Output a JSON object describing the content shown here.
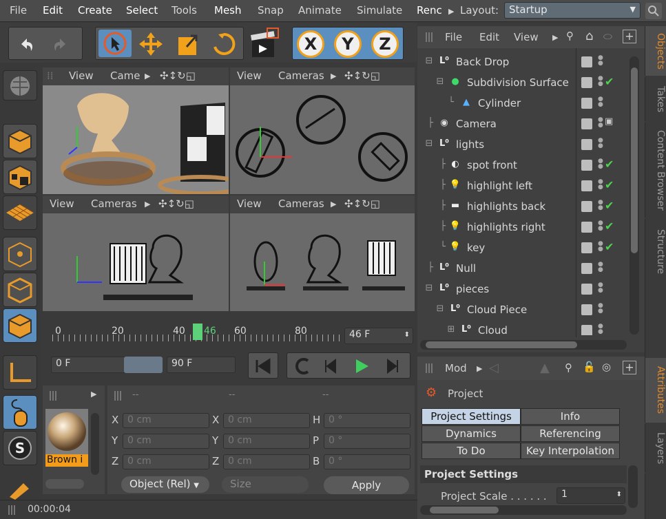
{
  "menubar": {
    "items": [
      "File",
      "Edit",
      "Create",
      "Select",
      "Tools",
      "Mesh",
      "Snap",
      "Animate",
      "Simulate",
      "Renc"
    ],
    "layout_label": "Layout:",
    "layout_value": "Startup"
  },
  "viewports": [
    {
      "view": "View",
      "cameras": "Came"
    },
    {
      "view": "View",
      "cameras": "Cameras"
    },
    {
      "view": "View",
      "cameras": "Cameras"
    },
    {
      "view": "View",
      "cameras": "Cameras"
    }
  ],
  "toolbar": {
    "x": "X",
    "y": "Y",
    "z": "Z"
  },
  "objects": {
    "menu": [
      "File",
      "Edit",
      "View"
    ],
    "rows": [
      {
        "label": "Back Drop",
        "icon": "null-object-icon",
        "check": false
      },
      {
        "label": "Subdivision Surface",
        "icon": "subdivision-icon",
        "check": true
      },
      {
        "label": "Cylinder",
        "icon": "cylinder-icon",
        "check": false
      },
      {
        "label": "Camera",
        "icon": "camera-icon",
        "check": false
      },
      {
        "label": "lights",
        "icon": "null-object-icon",
        "check": false
      },
      {
        "label": "spot front",
        "icon": "spot-light-icon",
        "check": true
      },
      {
        "label": "highlight left",
        "icon": "light-icon",
        "check": true
      },
      {
        "label": "highlights back",
        "icon": "area-light-icon",
        "check": true
      },
      {
        "label": "highlights right",
        "icon": "light-icon",
        "check": true
      },
      {
        "label": "key",
        "icon": "light-icon",
        "check": true
      },
      {
        "label": "Null",
        "icon": "null-object-icon",
        "check": false
      },
      {
        "label": "pieces",
        "icon": "null-object-icon",
        "check": false
      },
      {
        "label": "Cloud Piece",
        "icon": "null-object-icon",
        "check": false
      },
      {
        "label": "Cloud",
        "icon": "null-object-icon",
        "check": false
      }
    ]
  },
  "side_tabs_top": [
    "Objects",
    "Takes",
    "Content Browser",
    "Structure"
  ],
  "side_tabs_bottom": [
    "Attributes",
    "Layers"
  ],
  "timeline": {
    "ticks": [
      "0",
      "20",
      "40",
      "46",
      "60",
      "80"
    ],
    "current_frame": "46 F",
    "start": "0 F",
    "end": "90 F",
    "progress": 0.51
  },
  "material": {
    "name": "Brown i"
  },
  "coords": {
    "header": [
      "--",
      "--",
      "--"
    ],
    "rows": [
      {
        "a": "X",
        "av": "0 cm",
        "b": "X",
        "bv": "0 cm",
        "c": "H",
        "cv": "0 °"
      },
      {
        "a": "Y",
        "av": "0 cm",
        "b": "Y",
        "bv": "0 cm",
        "c": "P",
        "cv": "0 °"
      },
      {
        "a": "Z",
        "av": "0 cm",
        "b": "Z",
        "bv": "0 cm",
        "c": "B",
        "cv": "0 °"
      }
    ],
    "mode": "Object (Rel)",
    "size": "Size",
    "apply": "Apply"
  },
  "attributes": {
    "mode": "Mod",
    "title": "Project",
    "tabs": [
      "Project Settings",
      "Info",
      "Dynamics",
      "Referencing",
      "To Do",
      "Key Interpolation"
    ],
    "section": "Project Settings",
    "scale_label": "Project Scale . . . . . .",
    "scale_value": "1"
  },
  "status": {
    "time": "00:00:04"
  }
}
